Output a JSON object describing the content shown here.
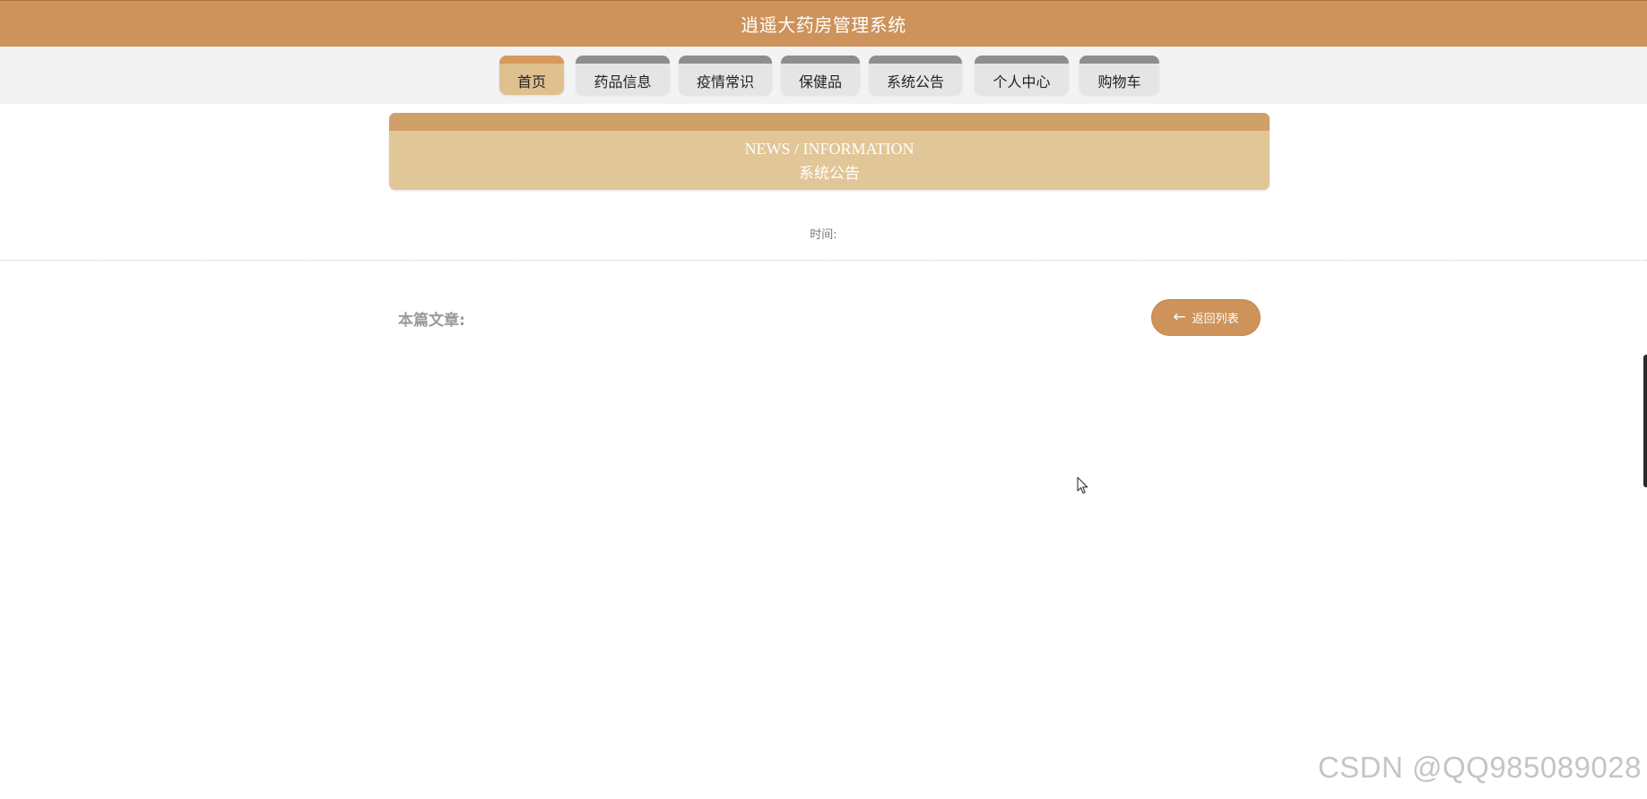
{
  "header": {
    "title": "逍遥大药房管理系统"
  },
  "nav": {
    "items": [
      {
        "label": "首页",
        "active": true
      },
      {
        "label": "药品信息",
        "active": false
      },
      {
        "label": "疫情常识",
        "active": false
      },
      {
        "label": "保健品",
        "active": false
      },
      {
        "label": "系统公告",
        "active": false
      },
      {
        "label": "个人中心",
        "active": false
      },
      {
        "label": "购物车",
        "active": false
      }
    ]
  },
  "banner": {
    "title_en": "NEWS / INFORMATION",
    "title_cn": "系统公告"
  },
  "article": {
    "time_label": "时间:",
    "time_value": "",
    "body_label": "本篇文章:",
    "back_label": "返回列表"
  },
  "watermark": {
    "text": "CSDN @QQ985089028"
  },
  "colors": {
    "primary": "#cd935b",
    "banner": "#e1c697",
    "nav_active": "#dfc08e",
    "nav_inactive": "#e5e5e5"
  },
  "icons": {
    "back": "arrow-left-icon",
    "cursor": "mouse-pointer-icon"
  }
}
